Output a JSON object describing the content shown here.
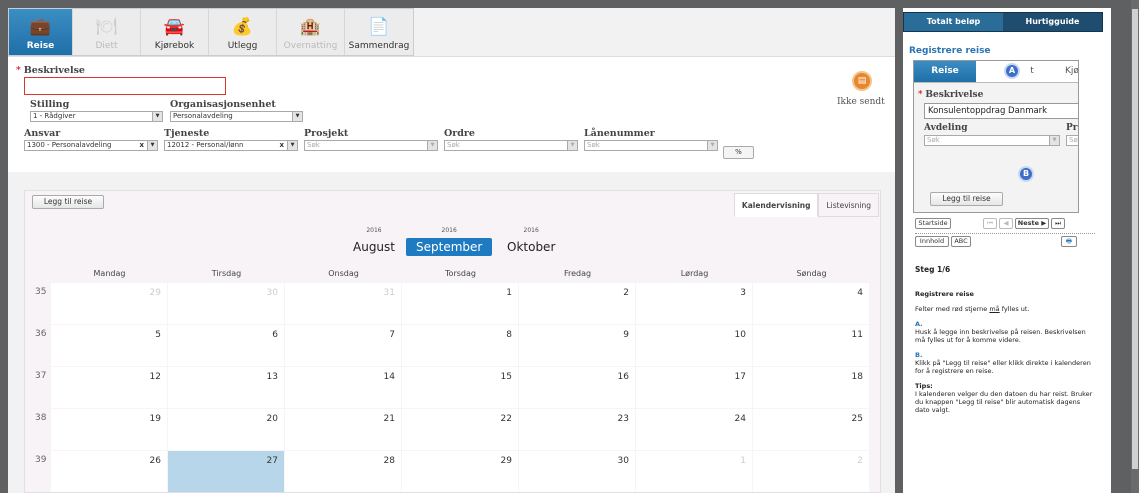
{
  "nav": {
    "tabs": [
      {
        "label": "Reise",
        "icon": "suitcase-icon",
        "glyph": "💼",
        "state": "active"
      },
      {
        "label": "Diett",
        "icon": "cutlery-icon",
        "glyph": "🍽",
        "state": "disabled"
      },
      {
        "label": "Kjørebok",
        "icon": "car-icon",
        "glyph": "🚘",
        "state": "normal"
      },
      {
        "label": "Utlegg",
        "icon": "money-bag-icon",
        "glyph": "💰",
        "state": "normal"
      },
      {
        "label": "Overnatting",
        "icon": "hotel-icon",
        "glyph": "🏨",
        "state": "disabled"
      },
      {
        "label": "Sammendrag",
        "icon": "summary-icon",
        "glyph": "📄",
        "state": "normal"
      }
    ]
  },
  "form": {
    "beskrivelse_label": "Beskrivelse",
    "beskrivelse_value": "",
    "stilling_label": "Stilling",
    "stilling_value": "1 - Rådgiver",
    "org_label": "Organisasjonsenhet",
    "org_value": "Personalavdeling",
    "ansvar_label": "Ansvar",
    "ansvar_value": "1300 - Personalavdeling",
    "tjeneste_label": "Tjeneste",
    "tjeneste_value": "12012 - Personal/lønn",
    "prosjekt_label": "Prosjekt",
    "prosjekt_placeholder": "Søk",
    "ordre_label": "Ordre",
    "ordre_placeholder": "Søk",
    "lanenummer_label": "Lånenummer",
    "lanenummer_placeholder": "Søk",
    "percent_button": "%",
    "status_text": "Ikke sendt"
  },
  "calendar": {
    "add_button": "Legg til reise",
    "view_tabs": [
      "Kalendervisning",
      "Listevisning"
    ],
    "months": [
      {
        "year": "2016",
        "name": "August",
        "active": false
      },
      {
        "year": "2016",
        "name": "September",
        "active": true
      },
      {
        "year": "2016",
        "name": "Oktober",
        "active": false
      }
    ],
    "weekdays": [
      "Mandag",
      "Tirsdag",
      "Onsdag",
      "Torsdag",
      "Fredag",
      "Lørdag",
      "Søndag"
    ],
    "weeks": [
      {
        "week": "35",
        "days": [
          [
            "29",
            "muted"
          ],
          [
            "30",
            "muted"
          ],
          [
            "31",
            "muted"
          ],
          [
            "1",
            ""
          ],
          [
            "2",
            ""
          ],
          [
            "3",
            ""
          ],
          [
            "4",
            ""
          ]
        ]
      },
      {
        "week": "36",
        "days": [
          [
            "5",
            ""
          ],
          [
            "6",
            ""
          ],
          [
            "7",
            ""
          ],
          [
            "8",
            ""
          ],
          [
            "9",
            ""
          ],
          [
            "10",
            ""
          ],
          [
            "11",
            ""
          ]
        ]
      },
      {
        "week": "37",
        "days": [
          [
            "12",
            ""
          ],
          [
            "13",
            ""
          ],
          [
            "14",
            ""
          ],
          [
            "15",
            ""
          ],
          [
            "16",
            ""
          ],
          [
            "17",
            ""
          ],
          [
            "18",
            ""
          ]
        ]
      },
      {
        "week": "38",
        "days": [
          [
            "19",
            ""
          ],
          [
            "20",
            ""
          ],
          [
            "21",
            ""
          ],
          [
            "22",
            ""
          ],
          [
            "23",
            ""
          ],
          [
            "24",
            ""
          ],
          [
            "25",
            ""
          ]
        ]
      },
      {
        "week": "39",
        "days": [
          [
            "26",
            ""
          ],
          [
            "27",
            "selected"
          ],
          [
            "28",
            ""
          ],
          [
            "29",
            ""
          ],
          [
            "30",
            ""
          ],
          [
            "1",
            "muted"
          ],
          [
            "2",
            "muted"
          ]
        ]
      }
    ]
  },
  "sidebar": {
    "tabs": [
      "Totalt beløp",
      "Hurtigguide"
    ],
    "title": "Registrere reise",
    "preview": {
      "tab_active": "Reise",
      "tab_partial_1": "t",
      "tab_partial_2": "Kjø",
      "marker_a": "A",
      "marker_b": "B",
      "beskrivelse_label": "Beskrivelse",
      "beskrivelse_value": "Konsulentoppdrag Danmark",
      "avdeling_label": "Avdeling",
      "avdeling_placeholder": "Søk",
      "pr_label": "Pr",
      "pr_placeholder": "Sø",
      "add_button": "Legg til reise"
    },
    "nav": {
      "startside": "Startside",
      "first": "⏮",
      "prev": "◀",
      "next": "Neste ▶",
      "last": "⏭",
      "innhold": "Innhold",
      "abc": "ABC",
      "print": "🖶"
    },
    "help": {
      "step": "Steg 1/6",
      "heading": "Registrere reise",
      "intro_pre": "Felter med rød stjerne ",
      "intro_em": "må",
      "intro_post": " fylles ut.",
      "a_label": "A.",
      "a_text": "Husk å legge inn beskrivelse på reisen. Beskrivelsen må fylles ut for å komme videre.",
      "b_label": "B.",
      "b_text": "Klikk på \"Legg til reise\" eller klikk direkte i kalenderen for å registrere en reise.",
      "tips_label": "Tips:",
      "tips_text": "I kalenderen velger du den datoen du har reist. Bruker du knappen \"Legg til reise\" blir automatisk dagens dato valgt."
    }
  },
  "colors": {
    "accent": "#1f7bc1",
    "selected_day": "#b8d6ea",
    "required_border": "#dd3333",
    "sidebar_header": "#1f4d6f",
    "status_icon": "#e8862b"
  }
}
